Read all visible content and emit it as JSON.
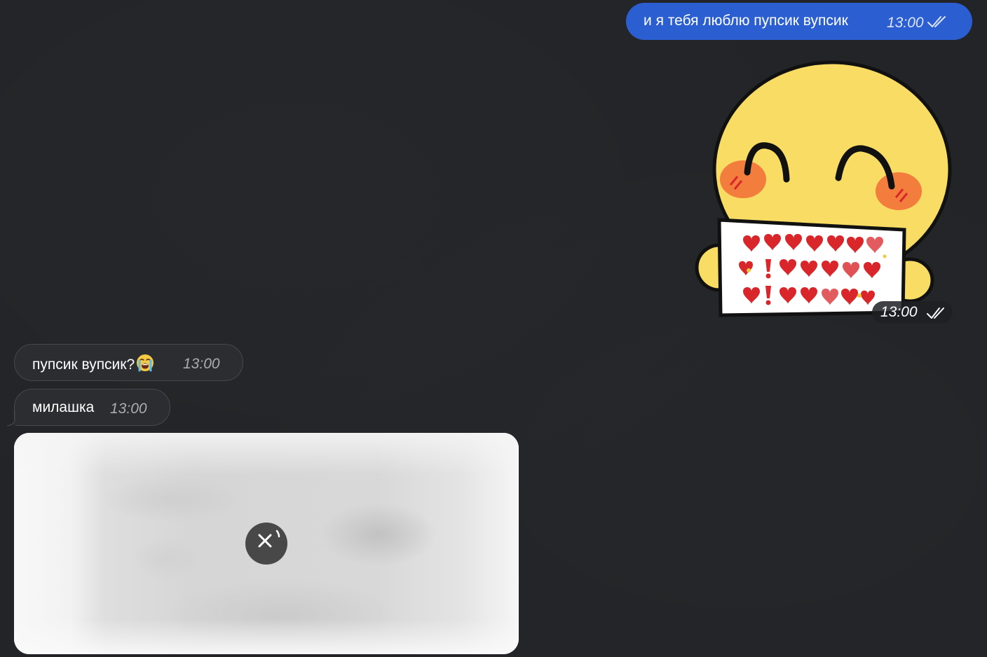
{
  "messages": [
    {
      "direction": "outgoing",
      "type": "text",
      "text": "и я тебя люблю пупсик вупсик",
      "time": "13:00",
      "status": "read"
    },
    {
      "direction": "outgoing",
      "type": "sticker",
      "sticker_icon": "smiling-face-holding-hearts-sign-sticker",
      "time": "13:00",
      "status": "read"
    },
    {
      "direction": "incoming",
      "type": "text",
      "text": "пупсик вупсик?",
      "emoji": "loudly-crying-face",
      "time": "13:00"
    },
    {
      "direction": "incoming",
      "type": "text",
      "text": "милашка",
      "time": "13:00"
    },
    {
      "direction": "incoming",
      "type": "media",
      "state": "loading",
      "action_icon": "cancel-download-icon"
    }
  ],
  "colors": {
    "background": "#222427",
    "outgoing_bubble": "#2b5fd1",
    "incoming_bubble": "#2b2d30",
    "incoming_border": "#45484c"
  }
}
